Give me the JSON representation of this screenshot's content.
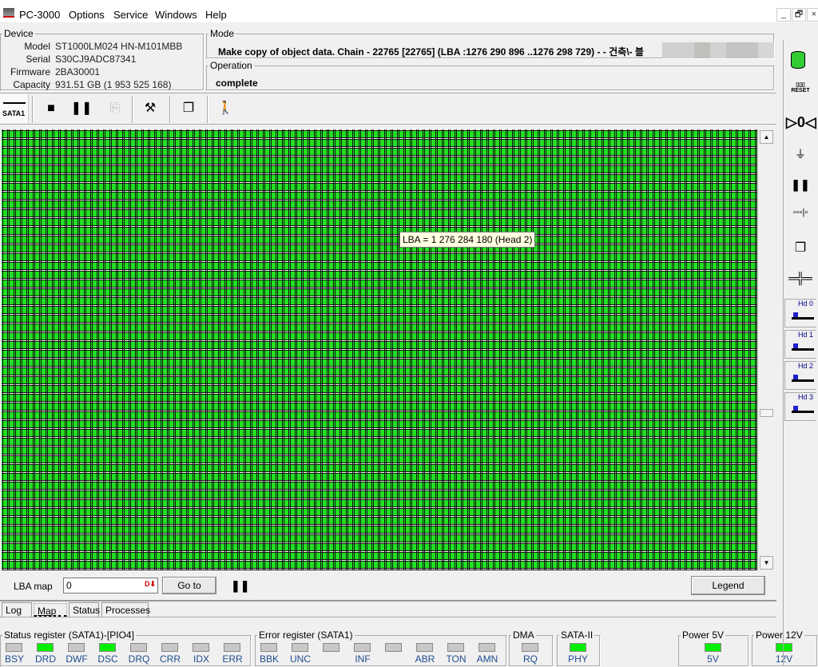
{
  "app": {
    "title": "PC-3000",
    "menu": [
      "Options",
      "Service",
      "Windows",
      "Help"
    ]
  },
  "window_controls": [
    "_",
    "🗗",
    "×"
  ],
  "device": {
    "legend": "Device",
    "fields": [
      {
        "label": "Model",
        "value": "ST1000LM024 HN-M101MBB"
      },
      {
        "label": "Serial",
        "value": "S30CJ9ADC87341"
      },
      {
        "label": "Firmware",
        "value": "2BA30001"
      },
      {
        "label": "Capacity",
        "value": "931.51 GB (1 953 525 168)"
      }
    ]
  },
  "mode": {
    "legend": "Mode",
    "text": "Make copy of object data. Chain - 22765 [22765] (LBA :1276 290 896 ..1276 298 729) - - 건축\\- 블"
  },
  "operation": {
    "legend": "Operation",
    "text": "complete"
  },
  "toolbar": {
    "port_label": "SATA1"
  },
  "map": {
    "tooltip": "LBA = 1 276 284 180 (Head 2)",
    "cell_color": "#22e022",
    "lba_label": "LBA map",
    "lba_value": "0",
    "goto_label": "Go to",
    "legend_label": "Legend"
  },
  "tabs": [
    {
      "label": "Log"
    },
    {
      "label": "Map",
      "active": true
    },
    {
      "label": "Status"
    },
    {
      "label": "Processes"
    }
  ],
  "status_register": {
    "legend": "Status register (SATA1)-[PIO4]",
    "bits": [
      {
        "label": "BSY",
        "on": false
      },
      {
        "label": "DRD",
        "on": true
      },
      {
        "label": "DWF",
        "on": false
      },
      {
        "label": "DSC",
        "on": true
      },
      {
        "label": "DRQ",
        "on": false
      },
      {
        "label": "CRR",
        "on": false
      },
      {
        "label": "IDX",
        "on": false
      },
      {
        "label": "ERR",
        "on": false
      }
    ]
  },
  "error_register": {
    "legend": "Error register (SATA1)",
    "bits": [
      {
        "label": "BBK",
        "on": false
      },
      {
        "label": "UNC",
        "on": false
      },
      {
        "label": "",
        "on": false
      },
      {
        "label": "INF",
        "on": false
      },
      {
        "label": "",
        "on": false
      },
      {
        "label": "ABR",
        "on": false
      },
      {
        "label": "TON",
        "on": false
      },
      {
        "label": "AMN",
        "on": false
      }
    ]
  },
  "dma": {
    "legend": "DMA",
    "bits": [
      {
        "label": "RQ",
        "on": false
      }
    ]
  },
  "sata": {
    "legend": "SATA-II",
    "bits": [
      {
        "label": "PHY",
        "on": true
      }
    ]
  },
  "power5": {
    "legend": "Power 5V",
    "bits": [
      {
        "label": "5V",
        "on": true
      }
    ]
  },
  "power12": {
    "legend": "Power 12V",
    "bits": [
      {
        "label": "12V",
        "on": true
      }
    ]
  },
  "side": {
    "reset_label": "RESET",
    "heads": [
      "Hd 0",
      "Hd 1",
      "Hd 2",
      "Hd 3"
    ]
  }
}
